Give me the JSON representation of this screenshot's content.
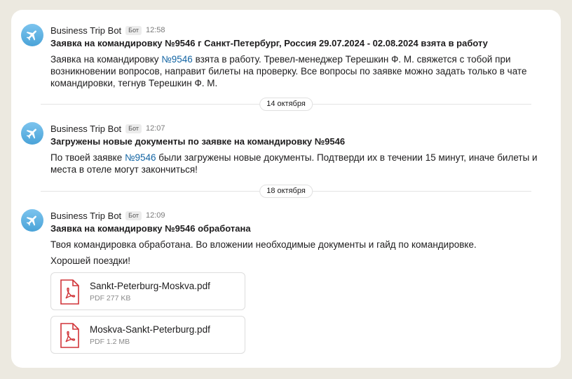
{
  "messages": [
    {
      "sender": "Business Trip Bot",
      "badge": "Бот",
      "time": "12:58",
      "title": "Заявка на командировку №9546 г Санкт-Петербург, Россия 29.07.2024 - 02.08.2024 взята в работу",
      "text_before": "Заявка на командировку ",
      "link": "№9546",
      "text_after": " взята в работу. Тревел-менеджер Терешкин Ф. М. свяжется с тобой при возникновении вопросов, направит билеты на проверку. Все вопросы по заявке можно задать только в чате командировки, тегнув Терешкин Ф. М."
    },
    {
      "sender": "Business Trip Bot",
      "badge": "Бот",
      "time": "12:07",
      "title": "Загружены новые документы по заявке на командировку №9546",
      "text_before": "По твоей заявке ",
      "link": "№9546",
      "text_after": " были загружены новые документы. Подтверди их в течении 15 минут, иначе билеты и места в отеле могут закончиться!"
    },
    {
      "sender": "Business Trip Bot",
      "badge": "Бот",
      "time": "12:09",
      "title": "Заявка на командировку №9546 обработана",
      "text": "Твоя командировка обработана. Во вложении необходимые документы и гайд по командировке.",
      "text2": "Хорошей поездки!",
      "files": [
        {
          "name": "Sankt-Peterburg-Moskva.pdf",
          "meta": "PDF 277 KB"
        },
        {
          "name": "Moskva-Sankt-Peterburg.pdf",
          "meta": "PDF 1.2 MB"
        }
      ]
    }
  ],
  "dates": [
    "14 октября",
    "18 октября"
  ],
  "colors": {
    "link": "#1264a3",
    "pdf_icon": "#d13438",
    "avatar": "#5aaee0"
  },
  "icons": {
    "avatar": "airplane-icon",
    "file": "pdf-file-icon"
  }
}
